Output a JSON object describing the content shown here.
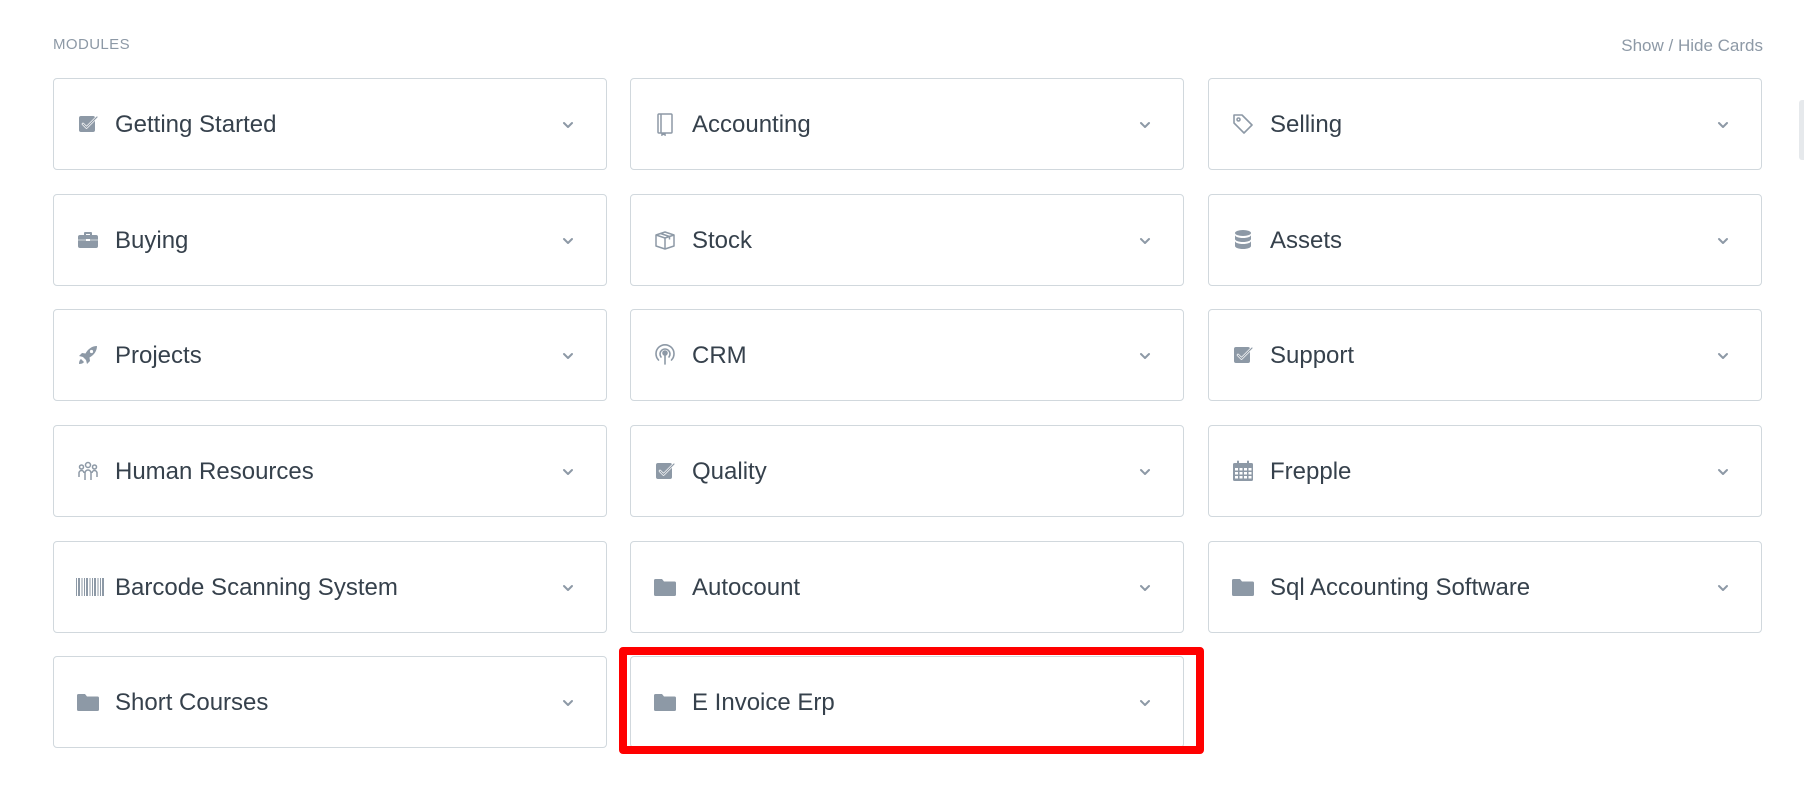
{
  "section": {
    "title": "MODULES",
    "toggle_label": "Show / Hide Cards"
  },
  "colors": {
    "icon": "#8d99a6",
    "text": "#36414c",
    "border": "#d1d8dd",
    "highlight": "#ff0000"
  },
  "modules": [
    {
      "label": "Getting Started",
      "icon": "checkbox-icon"
    },
    {
      "label": "Accounting",
      "icon": "book-icon"
    },
    {
      "label": "Selling",
      "icon": "tag-icon"
    },
    {
      "label": "Buying",
      "icon": "briefcase-icon"
    },
    {
      "label": "Stock",
      "icon": "box-icon"
    },
    {
      "label": "Assets",
      "icon": "database-icon"
    },
    {
      "label": "Projects",
      "icon": "rocket-icon"
    },
    {
      "label": "CRM",
      "icon": "podcast-icon"
    },
    {
      "label": "Support",
      "icon": "checkbox-icon"
    },
    {
      "label": "Human Resources",
      "icon": "users-icon"
    },
    {
      "label": "Quality",
      "icon": "checkbox-icon"
    },
    {
      "label": "Frepple",
      "icon": "calendar-icon"
    },
    {
      "label": "Barcode Scanning System",
      "icon": "barcode-icon"
    },
    {
      "label": "Autocount",
      "icon": "folder-icon"
    },
    {
      "label": "Sql Accounting Software",
      "icon": "folder-icon"
    },
    {
      "label": "Short Courses",
      "icon": "folder-icon"
    },
    {
      "label": "E Invoice Erp",
      "icon": "folder-icon"
    }
  ]
}
